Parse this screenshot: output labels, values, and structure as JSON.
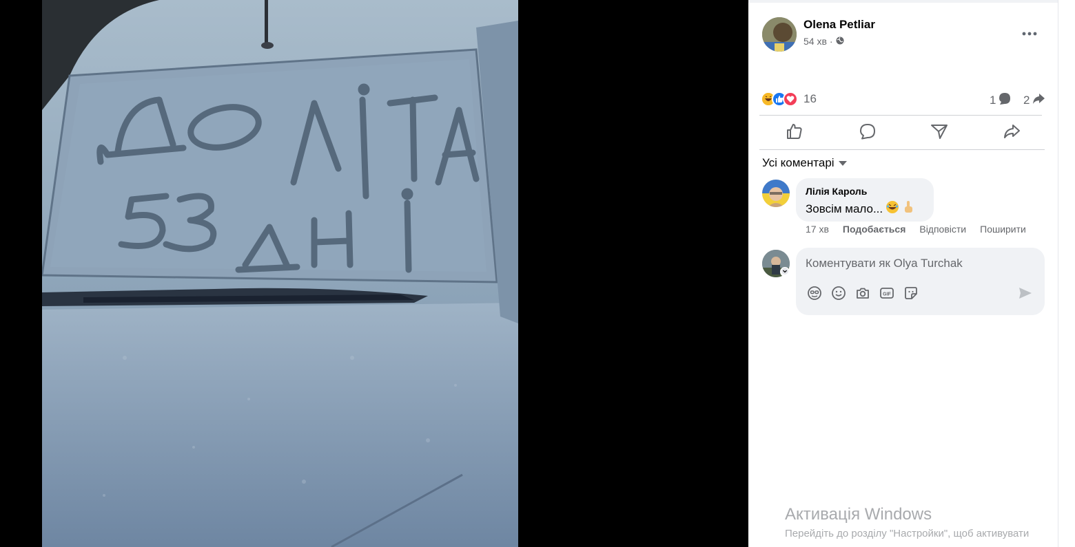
{
  "post": {
    "author_name": "Olena Petliar",
    "time": "54 хв",
    "separator": "·",
    "reaction_count": "16",
    "comment_count": "1",
    "share_count": "2",
    "reactions": [
      "haha-icon",
      "like-icon",
      "love-icon"
    ]
  },
  "actions": [
    "like-icon",
    "comment-icon",
    "send-icon",
    "share-icon"
  ],
  "comments": {
    "sort_label": "Усі коментарі",
    "items": [
      {
        "author": "Лілія Кароль",
        "text": "Зовсім мало...",
        "time": "17 хв",
        "like_label": "Подобається",
        "reply_label": "Відповісти",
        "share_label": "Поширити"
      }
    ],
    "composer_placeholder": "Коментувати як Olya Turchak"
  },
  "photo": {
    "snow_text_line1": "ДО ЛІТА",
    "snow_text_line2": "53 ДНІ"
  },
  "os_watermark": {
    "title": "Активація Windows",
    "subtitle": "Перейдіть до розділу \"Настройки\", щоб активувати"
  },
  "colors": {
    "accent": "#1877f2",
    "text": "#050505",
    "secondary": "#65676b",
    "bubble": "#f0f2f5"
  }
}
